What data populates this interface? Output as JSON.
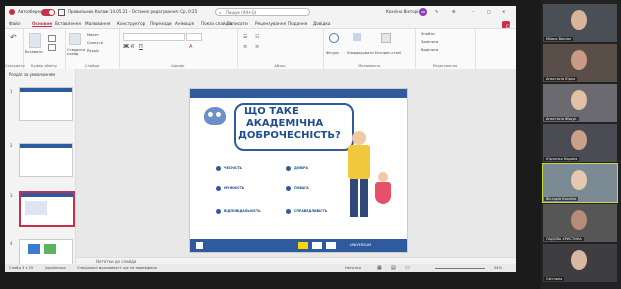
{
  "titlebar": {
    "autosave": "Автозбереження",
    "doc_title": "Правильних Колаж 14.05.21 - Останнє редагування: Ср, 0:25",
    "search_placeholder": "Пошук (Alt+Q)",
    "user_name": "Кохліна Вікторія",
    "user_initials": "КВ"
  },
  "menu": {
    "items": [
      "Файл",
      "Основне",
      "Вставлення",
      "Малювання",
      "Конструктор",
      "Переходи",
      "Анімація",
      "Показ слайдів",
      "Записати",
      "Рецензування",
      "Подання",
      "Довідка"
    ],
    "active_index": 1,
    "share_label": "Спільний доступ"
  },
  "ribbon": {
    "groups": [
      "Скасувати",
      "Буфер обміну",
      "Слайди",
      "Шрифт",
      "Абзац",
      "Малювання",
      "Редагування"
    ],
    "paste_label": "Вставити",
    "new_slide_label": "Створити слайд",
    "layout_label": "Макет",
    "reset_label": "Скинути",
    "section_label": "Розділ",
    "find_label": "Знайти",
    "replace_label": "Замінити",
    "select_label": "Виділити",
    "shapes_label": "Фігури",
    "arrange_label": "Упорядкувати",
    "quick_styles_label": "Експрес-стилі"
  },
  "sidebar": {
    "section_title": "Розділ за умовчанням",
    "thumbs": [
      "1",
      "2",
      "3",
      "4"
    ],
    "selected": "3"
  },
  "slide": {
    "title_line1": "ЩО ТАКЕ",
    "title_line2": "АКАДЕМІЧНА",
    "title_line3": "ДОБРОЧЕСНІСТЬ?",
    "items_left": [
      "ЧЕСНІСТЬ",
      "МУЖНІСТЬ",
      "ВІДПОВІДАЛЬНІСТЬ"
    ],
    "items_right": [
      "ДОВІРА",
      "ПОВАГА",
      "СПРАВЕДЛИВІСТЬ"
    ],
    "footer_logo_right": "UNIVERSUM"
  },
  "notes_label": "Нотатки до слайда",
  "status": {
    "slide_counter": "Слайд 3 з 29",
    "language": "українська",
    "accessibility": "Спеціальні можливості: ще не перевірено",
    "notes_button": "Нотатки",
    "zoom": "54%"
  },
  "gallery": {
    "participants": [
      {
        "name": "Milana Bondar",
        "active": false
      },
      {
        "name": "Анастасія Юрко",
        "active": false
      },
      {
        "name": "Анастасія Фіщук",
        "active": false
      },
      {
        "name": "Юрченко Карина",
        "active": false
      },
      {
        "name": "Вікторія Кохліна",
        "active": true
      },
      {
        "name": "ЛАДОВА ХРИСТИНА",
        "active": false
      },
      {
        "name": "Світлана",
        "active": false
      }
    ]
  },
  "colors": {
    "accent": "#c4314b",
    "slide_blue": "#2f5b9e",
    "title_blue": "#1f4e8c"
  }
}
